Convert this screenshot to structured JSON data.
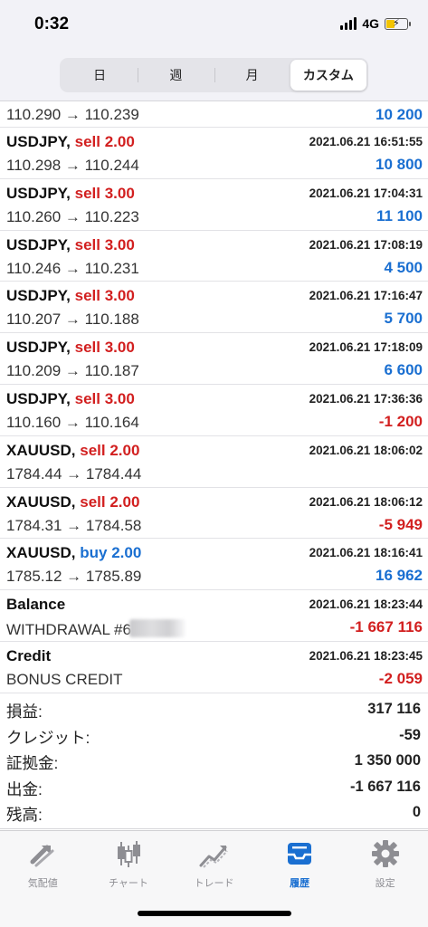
{
  "status": {
    "time": "0:32",
    "network": "4G"
  },
  "period_tabs": [
    {
      "label": "日"
    },
    {
      "label": "週"
    },
    {
      "label": "月"
    },
    {
      "label": "カスタム",
      "active": true
    }
  ],
  "deals": [
    {
      "price": "110.290 → 110.239",
      "profit": "10 200",
      "profit_sign": "pos",
      "partial": true
    },
    {
      "symbol": "USDJPY,",
      "side": "sell 2.00",
      "side_type": "sell",
      "time": "2021.06.21 16:51:55",
      "price": "110.298 → 110.244",
      "profit": "10 800",
      "profit_sign": "pos"
    },
    {
      "symbol": "USDJPY,",
      "side": "sell 3.00",
      "side_type": "sell",
      "time": "2021.06.21 17:04:31",
      "price": "110.260 → 110.223",
      "profit": "11 100",
      "profit_sign": "pos"
    },
    {
      "symbol": "USDJPY,",
      "side": "sell 3.00",
      "side_type": "sell",
      "time": "2021.06.21 17:08:19",
      "price": "110.246 → 110.231",
      "profit": "4 500",
      "profit_sign": "pos"
    },
    {
      "symbol": "USDJPY,",
      "side": "sell 3.00",
      "side_type": "sell",
      "time": "2021.06.21 17:16:47",
      "price": "110.207 → 110.188",
      "profit": "5 700",
      "profit_sign": "pos"
    },
    {
      "symbol": "USDJPY,",
      "side": "sell 3.00",
      "side_type": "sell",
      "time": "2021.06.21 17:18:09",
      "price": "110.209 → 110.187",
      "profit": "6 600",
      "profit_sign": "pos"
    },
    {
      "symbol": "USDJPY,",
      "side": "sell 3.00",
      "side_type": "sell",
      "time": "2021.06.21 17:36:36",
      "price": "110.160 → 110.164",
      "profit": "-1 200",
      "profit_sign": "neg"
    },
    {
      "symbol": "XAUUSD,",
      "side": "sell 2.00",
      "side_type": "sell",
      "time": "2021.06.21 18:06:02",
      "price": "1784.44 → 1784.44",
      "profit": "",
      "profit_sign": "neutral"
    },
    {
      "symbol": "XAUUSD,",
      "side": "sell 2.00",
      "side_type": "sell",
      "time": "2021.06.21 18:06:12",
      "price": "1784.31 → 1784.58",
      "profit": "-5 949",
      "profit_sign": "neg"
    },
    {
      "symbol": "XAUUSD,",
      "side": "buy 2.00",
      "side_type": "buy",
      "time": "2021.06.21 18:16:41",
      "price": "1785.12 → 1785.89",
      "profit": "16 962",
      "profit_sign": "pos"
    },
    {
      "symbol": "Balance",
      "side": "",
      "side_type": "",
      "time": "2021.06.21 18:23:44",
      "price": "WITHDRAWAL #6",
      "redacted": true,
      "profit": "-1 667 116",
      "profit_sign": "neg"
    },
    {
      "symbol": "Credit",
      "side": "",
      "side_type": "",
      "time": "2021.06.21 18:23:45",
      "price": "BONUS CREDIT",
      "profit": "-2 059",
      "profit_sign": "neg"
    }
  ],
  "summary": [
    {
      "label": "損益:",
      "value": "317 116"
    },
    {
      "label": "クレジット:",
      "value": "-59"
    },
    {
      "label": "証拠金:",
      "value": "1 350 000"
    },
    {
      "label": "出金:",
      "value": "-1 667 116"
    },
    {
      "label": "残高:",
      "value": "0"
    }
  ],
  "tabbar": [
    {
      "label": "気配値",
      "icon": "quotes-arrows-icon"
    },
    {
      "label": "チャート",
      "icon": "candlestick-chart-icon"
    },
    {
      "label": "トレード",
      "icon": "trade-trend-icon"
    },
    {
      "label": "履歴",
      "icon": "history-inbox-icon",
      "active": true
    },
    {
      "label": "設定",
      "icon": "settings-gear-icon"
    }
  ],
  "colors": {
    "profit_positive": "#1a6fd1",
    "profit_negative": "#d21f1f",
    "accent": "#1a6fd1"
  }
}
